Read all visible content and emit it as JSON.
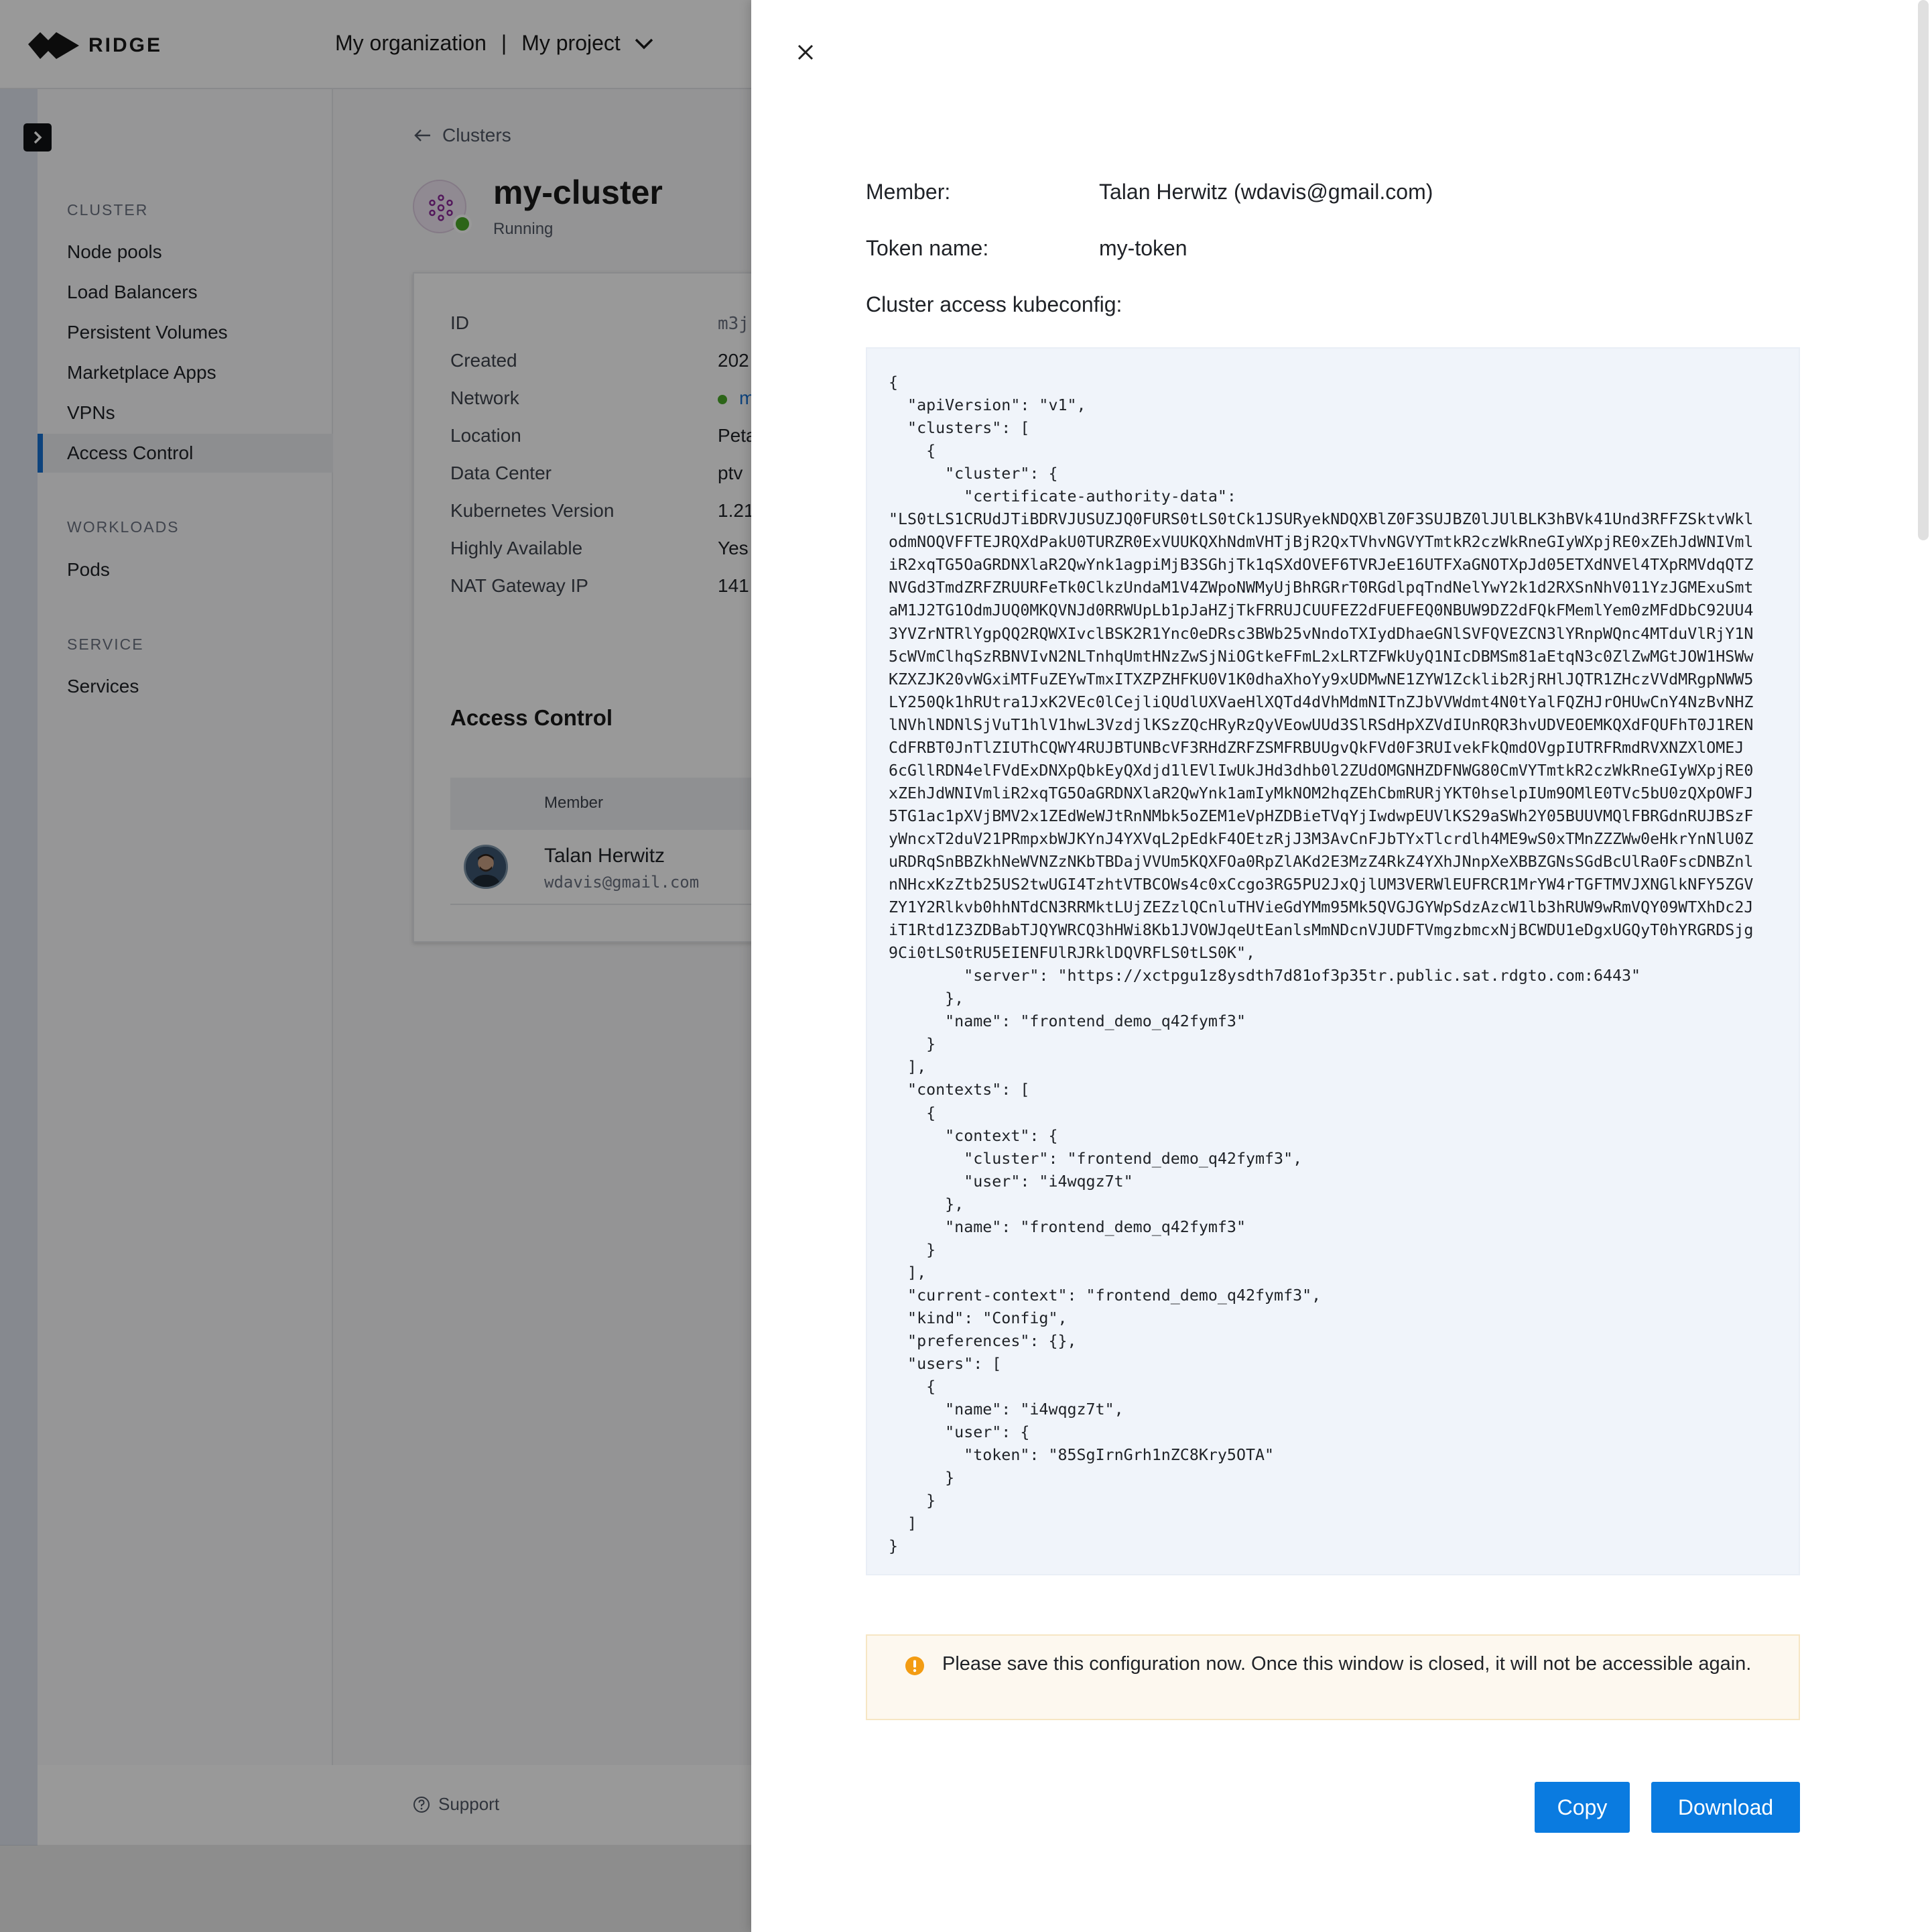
{
  "brand": {
    "name": "RIDGE"
  },
  "header": {
    "org": "My organization",
    "separator": "|",
    "project": "My project"
  },
  "sidebar": {
    "sections": [
      {
        "title": "CLUSTER",
        "items": [
          "Node pools",
          "Load Balancers",
          "Persistent Volumes",
          "Marketplace Apps",
          "VPNs",
          "Access Control"
        ]
      },
      {
        "title": "WORKLOADS",
        "items": [
          "Pods"
        ]
      },
      {
        "title": "SERVICE",
        "items": [
          "Services"
        ]
      }
    ],
    "active_item": "Access Control"
  },
  "cluster": {
    "back_label": "Clusters",
    "name": "my-cluster",
    "status": "Running",
    "details": [
      {
        "label": "ID",
        "value": "m3j"
      },
      {
        "label": "Created",
        "value": "202"
      },
      {
        "label": "Network",
        "value": "m"
      },
      {
        "label": "Location",
        "value": "Peta"
      },
      {
        "label": "Data Center",
        "value": "ptv"
      },
      {
        "label": "Kubernetes Version",
        "value": "1.21"
      },
      {
        "label": "Highly Available",
        "value": "Yes"
      },
      {
        "label": "NAT Gateway IP",
        "value": "141"
      }
    ]
  },
  "access_control": {
    "title": "Access Control",
    "column_member": "Member",
    "member_name": "Talan Herwitz",
    "member_email": "wdavis@gmail.com"
  },
  "footer": {
    "support": "Support"
  },
  "drawer": {
    "member_label": "Member:",
    "member_value": "Talan Herwitz (wdavis@gmail.com)",
    "token_label": "Token name:",
    "token_value": "my-token",
    "kubeconfig_label": "Cluster access kubeconfig:",
    "kubeconfig": "{\n  \"apiVersion\": \"v1\",\n  \"clusters\": [\n    {\n      \"cluster\": {\n        \"certificate-authority-data\":\n\"LS0tLS1CRUdJTiBDRVJUSUZJQ0FURS0tLS0tCk1JSURyekNDQXBlZ0F3SUJBZ0lJUlBLK3hBVk41Und3RFFZSktvWkl\nodmNOQVFFTEJRQXdPakU0TURZR0ExVUUKQXhNdmVHTjBjR2QxTVhvNGVYTmtkR2czWkRneGIyWXpjRE0xZEhJdWNIVml\niR2xqTG5OaGRDNXlaR2QwYnk1agpiMjB3SGhjTk1qSXdOVEF6TVRJeE16UTFXaGNOTXpJd05ETXdNVEl4TXpRMVdqQTZ\nNVGd3TmdZRFZRUURFeTk0ClkzUndaM1V4ZWpoNWMyUjBhRGRrT0RGdlpqTndNelYwY2k1d2RXSnNhV011YzJGMExuSmt\naM1J2TG1OdmJUQ0MKQVNJd0RRWUpLb1pJaHZjTkFRRUJCUUFEZ2dFUEFEQ0NBUW9DZ2dFQkFMemlYem0zMFdDbC92UU4\n3YVZrNTRlYgpQQ2RQWXIvclBSK2R1Ync0eDRsc3BWb25vNndoTXIydDhaeGNlSVFQVEZCN3lYRnpWQnc4MTduVlRjY1N\n5cWVmClhqSzRBNVIvN2NLTnhqUmtHNzZwSjNiOGtkeFFmL2xLRTZFWkUyQ1NIcDBMSm81aEtqN3c0ZlZwMGtJOW1HSWw\nKZXZJK20vWGxiMTFuZEYwTmxITXZPZHFKU0V1K0dhaXhoYy9xUDMwNE1ZYW1Zcklib2RjRHlJQTR1ZHczVVdMRgpNWW5\nLY250Qk1hRUtra1JxK2VEc0lCejliQUdlUXVaeHlXQTd4dVhMdmNITnZJbVVWdmt4N0tYalFQZHJrOHUwCnY4NzBvNHZ\nlNVhlNDNlSjVuT1hlV1hwL3VzdjlKSzZQcHRyRzQyVEowUUd3SlRSdHpXZVdIUnRQR3hvUDVEOEMKQXdFQUFhT0J1REN\nCdFRBT0JnTlZIUThCQWY4RUJBTUNBcVF3RHdZRFZSMFRBUUgvQkFVd0F3RUIvekFkQmdOVgpIUTRFRmdRVXNZXlOMEJ\n6cGllRDN4elFVdExDNXpQbkEyQXdjd1lEVlIwUkJHd3dhb0l2ZUdOMGNHZDFNWG80CmVYTmtkR2czWkRneGIyWXpjRE0\nxZEhJdWNIVmliR2xqTG5OaGRDNXlaR2QwYnk1amIyMkNOM2hqZEhCbmRURjYKT0hselpIUm9OMlE0TVc5bU0zQXpOWFJ\n5TG1ac1pXVjBMV2x1ZEdWeWJtRnNMbk5oZEM1eVpHZDBieTVqYjIwdwpEUVlKS29aSWh2Y05BUUVMQlFBRGdnRUJBSzF\nyWncxT2duV21PRmpxbWJKYnJ4YXVqL2pEdkF4OEtzRjJ3M3AvCnFJbTYxTlcrdlh4ME9wS0xTMnZZZWw0eHkrYnNlU0Z\nuRDRqSnBBZkhNeWVNZzNKbTBDajVVUm5KQXFOa0RpZlAKd2E3MzZ4RkZ4YXhJNnpXeXBBZGNsSGdBcUlRa0FscDNBZnl\nnNHcxKzZtb25US2twUGI4TzhtVTBCOWs4c0xCcgo3RG5PU2JxQjlUM3VERWlEUFRCR1MrYW4rTGFTMVJXNGlkNFY5ZGV\nZY1Y2Rlkvb0hhNTdCN3RRMktLUjZEZzlQCnluTHVieGdYMm95Mk5QVGJGYWpSdzAzcW1lb3hRUW9wRmVQY09WTXhDc2J\niT1Rtd1Z3ZDBabTJQYWRCQ3hHWi8Kb1JVOWJqeUtEanlsMmNDcnVJUDFTVmgzbmcxNjBCWDU1eDgxUGQyT0hYRGRDSjg\n9Ci0tLS0tRU5EIENFUlRJRklDQVRFLS0tLS0K\",\n        \"server\": \"https://xctpgu1z8ysdth7d81of3p35tr.public.sat.rdgto.com:6443\"\n      },\n      \"name\": \"frontend_demo_q42fymf3\"\n    }\n  ],\n  \"contexts\": [\n    {\n      \"context\": {\n        \"cluster\": \"frontend_demo_q42fymf3\",\n        \"user\": \"i4wqgz7t\"\n      },\n      \"name\": \"frontend_demo_q42fymf3\"\n    }\n  ],\n  \"current-context\": \"frontend_demo_q42fymf3\",\n  \"kind\": \"Config\",\n  \"preferences\": {},\n  \"users\": [\n    {\n      \"name\": \"i4wqgz7t\",\n      \"user\": {\n        \"token\": \"85SgIrnGrh1nZC8Kry5OTA\"\n      }\n    }\n  ]\n}",
    "notice": "Please save this configuration now. Once this window is closed, it will not be accessible again.",
    "copy_label": "Copy",
    "download_label": "Download"
  },
  "colors": {
    "accent": "#0a7be0",
    "active_nav": "#1670d0",
    "status_running": "#4aa829",
    "warning": "#f39c12",
    "code_bg": "#f0f4fa",
    "notice_bg": "#fdf8ef"
  },
  "icons": {
    "close": "close-icon",
    "back": "arrow-left-icon",
    "dropdown": "chevron-down-icon",
    "expand": "chevron-right-icon",
    "warning": "exclamation-circle-icon",
    "support": "question-circle-icon",
    "cluster": "cluster-icon"
  }
}
